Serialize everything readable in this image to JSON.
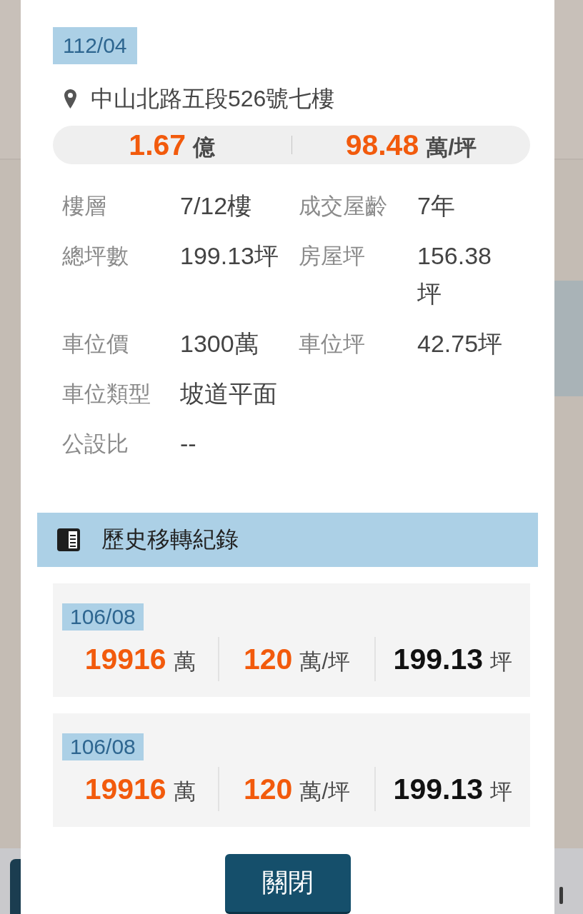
{
  "record": {
    "date": "112/04",
    "address": "中山北路五段526號七樓",
    "price": [
      {
        "value": "1.67",
        "unit": "億"
      },
      {
        "value": "98.48",
        "unit": "萬/坪"
      }
    ],
    "details": [
      [
        {
          "label": "樓層",
          "value": "7/12樓"
        },
        {
          "label": "成交屋齡",
          "value": "7年"
        }
      ],
      [
        {
          "label": "總坪數",
          "value": "199.13坪"
        },
        {
          "label": "房屋坪",
          "value": "156.38坪"
        }
      ],
      [
        {
          "label": "車位價",
          "value": "1300萬"
        },
        {
          "label": "車位坪",
          "value": "42.75坪"
        }
      ],
      [
        {
          "label": "車位類型",
          "value": "坡道平面"
        }
      ],
      [
        {
          "label": "公設比",
          "value": "--"
        }
      ]
    ]
  },
  "history": {
    "title": "歷史移轉紀錄",
    "records": [
      {
        "date": "106/08",
        "figures": [
          {
            "kind": "price",
            "value": "19916",
            "unit": "萬"
          },
          {
            "kind": "unit_price",
            "value": "120",
            "unit": "萬/坪"
          },
          {
            "kind": "area",
            "value": "199.13",
            "unit": "坪"
          }
        ]
      },
      {
        "date": "106/08",
        "figures": [
          {
            "kind": "price",
            "value": "19916",
            "unit": "萬"
          },
          {
            "kind": "unit_price",
            "value": "120",
            "unit": "萬/坪"
          },
          {
            "kind": "area",
            "value": "199.13",
            "unit": "坪"
          }
        ]
      }
    ]
  },
  "close_button": {
    "label": "關閉"
  }
}
